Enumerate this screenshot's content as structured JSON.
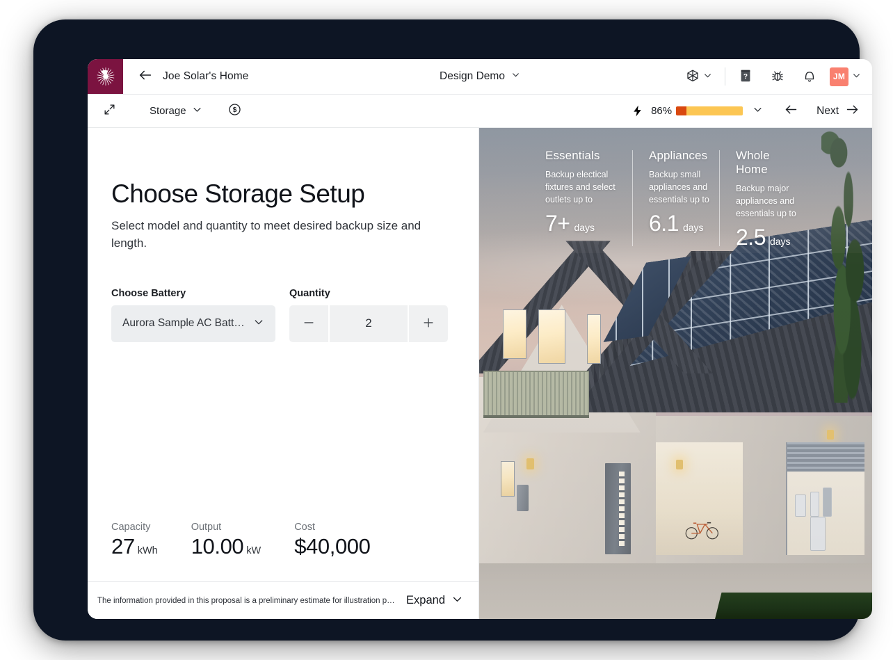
{
  "topbar": {
    "logo_icon": "aurora-sunburst-logo",
    "back_icon": "arrow-left-icon",
    "project_title": "Joe Solar's Home",
    "center_title": "Design Demo",
    "center_chevron_icon": "chevron-down-icon",
    "cube_icon": "3d-cube-icon",
    "help_icon": "help-book-icon",
    "bug_icon": "bug-icon",
    "bell_icon": "bell-notification-icon",
    "avatar_initials": "JM",
    "avatar_color": "#F9806F",
    "brand_color": "#7B1340"
  },
  "subbar": {
    "expand_icon": "expand-diagonal-arrows-icon",
    "mode_label": "Storage",
    "mode_chevron_icon": "chevron-down-icon",
    "cost_icon": "dollar-circle-icon",
    "bolt_icon": "lightning-bolt-icon",
    "percent_label": "86%",
    "progress_chevron_icon": "chevron-down-icon",
    "progress_segment_1_color": "#D9480F",
    "progress_segment_2_color": "#FCC653",
    "back_icon": "arrow-left-icon",
    "next_label": "Next",
    "next_icon": "arrow-right-icon"
  },
  "main": {
    "title": "Choose Storage Setup",
    "subtitle": "Select model and quantity to meet desired backup size and length.",
    "battery_field_label": "Choose Battery",
    "battery_value": "Aurora Sample AC Batt…",
    "battery_chevron_icon": "chevron-down-icon",
    "quantity_field_label": "Quantity",
    "quantity_minus_icon": "minus-icon",
    "quantity_value": "2",
    "quantity_plus_icon": "plus-icon",
    "stats": [
      {
        "caption": "Capacity",
        "value": "27",
        "unit": "kWh"
      },
      {
        "caption": "Output",
        "value": "10.00",
        "unit": "kW"
      },
      {
        "caption": "Cost",
        "value": "$40,000",
        "unit": ""
      }
    ]
  },
  "disclaimer": {
    "text": "The information provided in this proposal is a preliminary estimate for illustration purp…",
    "expand_label": "Expand",
    "expand_icon": "chevron-down-icon"
  },
  "backup_cards": [
    {
      "title": "Essentials",
      "description": "Backup electical fixtures and select outlets up to",
      "number": "7+",
      "unit": "days"
    },
    {
      "title": "Appliances",
      "description": "Backup small appliances and essentials up to",
      "number": "6.1",
      "unit": "days"
    },
    {
      "title": "Whole Home",
      "description": "Backup major appliances and essentials up to",
      "number": "2.5",
      "unit": "days"
    }
  ]
}
